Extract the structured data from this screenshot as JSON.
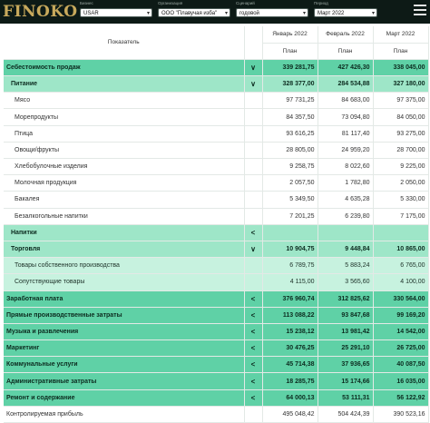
{
  "app": {
    "logo": "FINOKO"
  },
  "filters": [
    {
      "label": "Бизнес",
      "value": "USAR"
    },
    {
      "label": "Организация",
      "value": "ООО \"Плавучая изба\""
    },
    {
      "label": "Сценарий",
      "value": "годовой"
    },
    {
      "label": "Период",
      "value": "Март 2022"
    }
  ],
  "table": {
    "header": {
      "indicator": "Показатель",
      "months": [
        "Январь 2022",
        "Февраль 2022",
        "Март 2022"
      ],
      "plan": [
        "План",
        "План",
        "План"
      ]
    },
    "rows": [
      {
        "type": "main",
        "name": "Себестоимость продаж",
        "toggle": "∨",
        "values": [
          "339 281,75",
          "427 426,30",
          "338 045,00"
        ]
      },
      {
        "type": "group",
        "name": "Питание",
        "toggle": "∨",
        "values": [
          "328 377,00",
          "284 534,88",
          "327 180,00"
        ]
      },
      {
        "type": "leaf",
        "name": "Мясо",
        "toggle": "",
        "values": [
          "97 731,25",
          "84 683,00",
          "97 375,00"
        ]
      },
      {
        "type": "leaf",
        "name": "Морепродукты",
        "toggle": "",
        "values": [
          "84 357,50",
          "73 094,80",
          "84 050,00"
        ]
      },
      {
        "type": "leaf",
        "name": "Птица",
        "toggle": "",
        "values": [
          "93 616,25",
          "81 117,40",
          "93 275,00"
        ]
      },
      {
        "type": "leaf",
        "name": "Овощи/фрукты",
        "toggle": "",
        "values": [
          "28 805,00",
          "24 959,20",
          "28 700,00"
        ]
      },
      {
        "type": "leaf",
        "name": "Хлебобулочные изделия",
        "toggle": "",
        "values": [
          "9 258,75",
          "8 022,60",
          "9 225,00"
        ]
      },
      {
        "type": "leaf",
        "name": "Молочная продукция",
        "toggle": "",
        "values": [
          "2 057,50",
          "1 782,80",
          "2 050,00"
        ]
      },
      {
        "type": "leaf",
        "name": "Бакалея",
        "toggle": "",
        "values": [
          "5 349,50",
          "4 635,28",
          "5 330,00"
        ]
      },
      {
        "type": "leaf",
        "name": "Безалкогольные напитки",
        "toggle": "",
        "values": [
          "7 201,25",
          "6 239,80",
          "7 175,00"
        ]
      },
      {
        "type": "group",
        "name": "Напитки",
        "toggle": "<",
        "values": [
          "",
          "",
          ""
        ]
      },
      {
        "type": "group",
        "name": "Торговля",
        "toggle": "∨",
        "values": [
          "10 904,75",
          "9 448,84",
          "10 865,00"
        ]
      },
      {
        "type": "light",
        "name": "Товары собственного производства",
        "toggle": "",
        "values": [
          "6 789,75",
          "5 883,24",
          "6 765,00"
        ]
      },
      {
        "type": "light",
        "name": "Сопутствующие товары",
        "toggle": "",
        "values": [
          "4 115,00",
          "3 565,60",
          "4 100,00"
        ]
      },
      {
        "type": "main",
        "name": "Заработная плата",
        "toggle": "<",
        "values": [
          "376 960,74",
          "312 825,62",
          "330 564,00"
        ]
      },
      {
        "type": "main",
        "name": "Прямые производственные затраты",
        "toggle": "<",
        "values": [
          "113 088,22",
          "93 847,68",
          "99 169,20"
        ]
      },
      {
        "type": "main",
        "name": "Музыка и развлечения",
        "toggle": "<",
        "values": [
          "15 238,12",
          "13 981,42",
          "14 542,00"
        ]
      },
      {
        "type": "main",
        "name": "Маркетинг",
        "toggle": "<",
        "values": [
          "30 476,25",
          "25 291,10",
          "26 725,00"
        ]
      },
      {
        "type": "main",
        "name": "Коммунальные услуги",
        "toggle": "<",
        "values": [
          "45 714,38",
          "37 936,65",
          "40 087,50"
        ]
      },
      {
        "type": "main",
        "name": "Административные затраты",
        "toggle": "<",
        "values": [
          "18 285,75",
          "15 174,66",
          "16 035,00"
        ]
      },
      {
        "type": "main",
        "name": "Ремонт и содержание",
        "toggle": "<",
        "values": [
          "64 000,13",
          "53 111,31",
          "56 122,92"
        ]
      },
      {
        "type": "total",
        "name": "Контролируемая прибыль",
        "toggle": "",
        "values": [
          "495 048,42",
          "504 424,39",
          "390 523,16"
        ]
      }
    ]
  }
}
